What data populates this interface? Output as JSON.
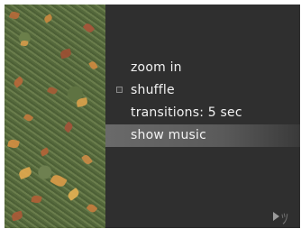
{
  "menu": {
    "items": [
      {
        "label": "zoom in"
      },
      {
        "label": "shuffle",
        "checkbox": true,
        "checked": false
      },
      {
        "label": "transitions: 5 sec"
      },
      {
        "label": "show music",
        "selected": true
      }
    ]
  },
  "photo": {
    "subject": "leaves-on-grass-photo"
  },
  "corner": {
    "icon": "play-arrow-icon",
    "logo": "stylized-glyph-icon"
  },
  "colors": {
    "panel_background": "#2f2f2f",
    "text": "#f2f2f2",
    "selected_highlight": "#6a6a6a"
  }
}
